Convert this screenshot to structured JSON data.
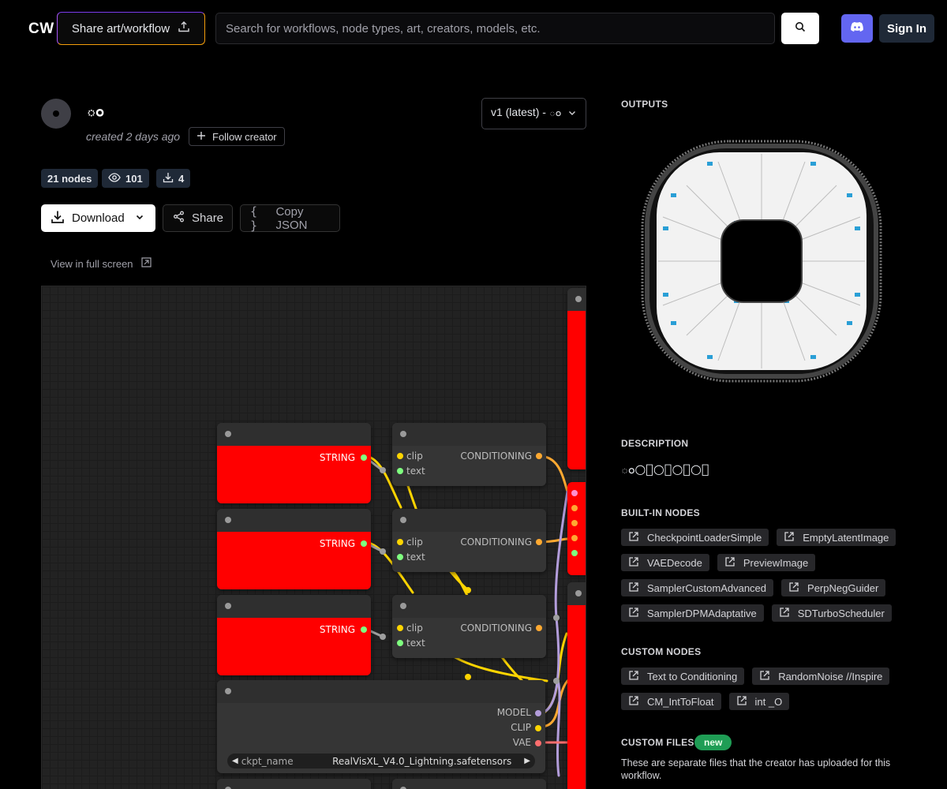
{
  "header": {
    "logo": "CW",
    "share_label": "Share art/workflow",
    "search_placeholder": "Search for workflows, node types, art, creators, models, etc.",
    "signin_label": "Sign In"
  },
  "workflow": {
    "title": "ం",
    "created": "created 2 days ago",
    "follow_label": "Follow creator",
    "version": "v1 (latest) - ం",
    "stats": {
      "nodes": "21 nodes",
      "views": "101",
      "downloads": "4"
    },
    "actions": {
      "download": "Download",
      "share": "Share",
      "copy_json": "Copy JSON"
    },
    "fullscreen_label": "View in full screen"
  },
  "canvas": {
    "nodes": [
      {
        "type": "string-node",
        "output": "STRING"
      },
      {
        "type": "string-node",
        "output": "STRING"
      },
      {
        "type": "string-node",
        "output": "STRING"
      },
      {
        "type": "text-to-conditioning",
        "inputs": [
          "clip",
          "text"
        ],
        "output": "CONDITIONING"
      },
      {
        "type": "text-to-conditioning",
        "inputs": [
          "clip",
          "text"
        ],
        "output": "CONDITIONING"
      },
      {
        "type": "text-to-conditioning",
        "inputs": [
          "clip",
          "text"
        ],
        "output": "CONDITIONING"
      },
      {
        "type": "checkpoint-loader",
        "outputs": [
          "MODEL",
          "CLIP",
          "VAE"
        ],
        "widget_name": "ckpt_name",
        "widget_value": "RealVisXL_V4.0_Lightning.safetensors"
      }
    ],
    "colors": {
      "bg": "#222222",
      "node": "#353535",
      "red": "#ff0000",
      "clip": "#ffd500",
      "cond": "#ffa931",
      "model": "#b39ddb",
      "vae": "#ff6e6e",
      "text": "#7fff7f"
    }
  },
  "panel": {
    "outputs_heading": "OUTPUTS",
    "description_heading": "DESCRIPTION",
    "description": "ం○ం○ం○ం○ం",
    "builtin_heading": "BUILT-IN NODES",
    "builtin_nodes": [
      "CheckpointLoaderSimple",
      "EmptyLatentImage",
      "VAEDecode",
      "PreviewImage",
      "SamplerCustomAdvanced",
      "PerpNegGuider",
      "SamplerDPMAdaptative",
      "SDTurboScheduler"
    ],
    "custom_heading": "CUSTOM NODES",
    "custom_nodes": [
      "Text to Conditioning",
      "RandomNoise //Inspire",
      "CM_IntToFloat",
      "int _O"
    ],
    "files_heading": "CUSTOM FILES",
    "files_badge": "new",
    "files_text": "These are separate files that the creator has uploaded for this workflow."
  }
}
